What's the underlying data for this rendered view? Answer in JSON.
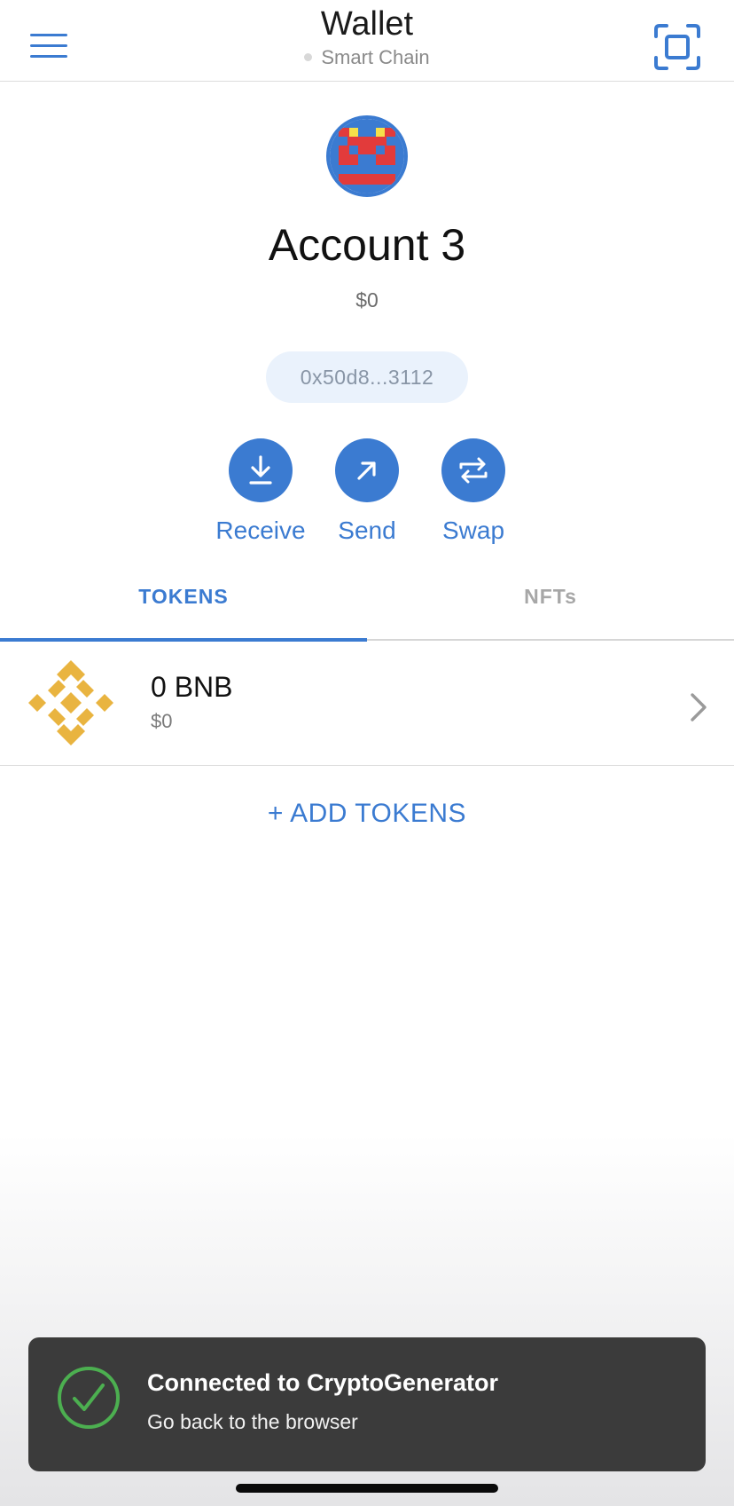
{
  "header": {
    "title": "Wallet",
    "network": "Smart Chain",
    "accent_color": "#3b7bd1"
  },
  "account": {
    "name": "Account 3",
    "balance": "$0",
    "address": "0x50d8...3112"
  },
  "actions": [
    {
      "label": "Receive",
      "icon": "download-icon"
    },
    {
      "label": "Send",
      "icon": "arrow-up-right-icon"
    },
    {
      "label": "Swap",
      "icon": "swap-arrows-icon"
    }
  ],
  "tabs": [
    {
      "label": "TOKENS",
      "active": true
    },
    {
      "label": "NFTs",
      "active": false
    }
  ],
  "tokens": [
    {
      "amount": "0 BNB",
      "value": "$0",
      "icon": "bnb-logo-icon",
      "icon_color": "#f0b90b"
    }
  ],
  "add_tokens_label": "+ ADD TOKENS",
  "toast": {
    "title": "Connected to CryptoGenerator",
    "subtitle": "Go back to the browser",
    "icon": "check-circle-icon",
    "icon_color": "#4caf50"
  }
}
